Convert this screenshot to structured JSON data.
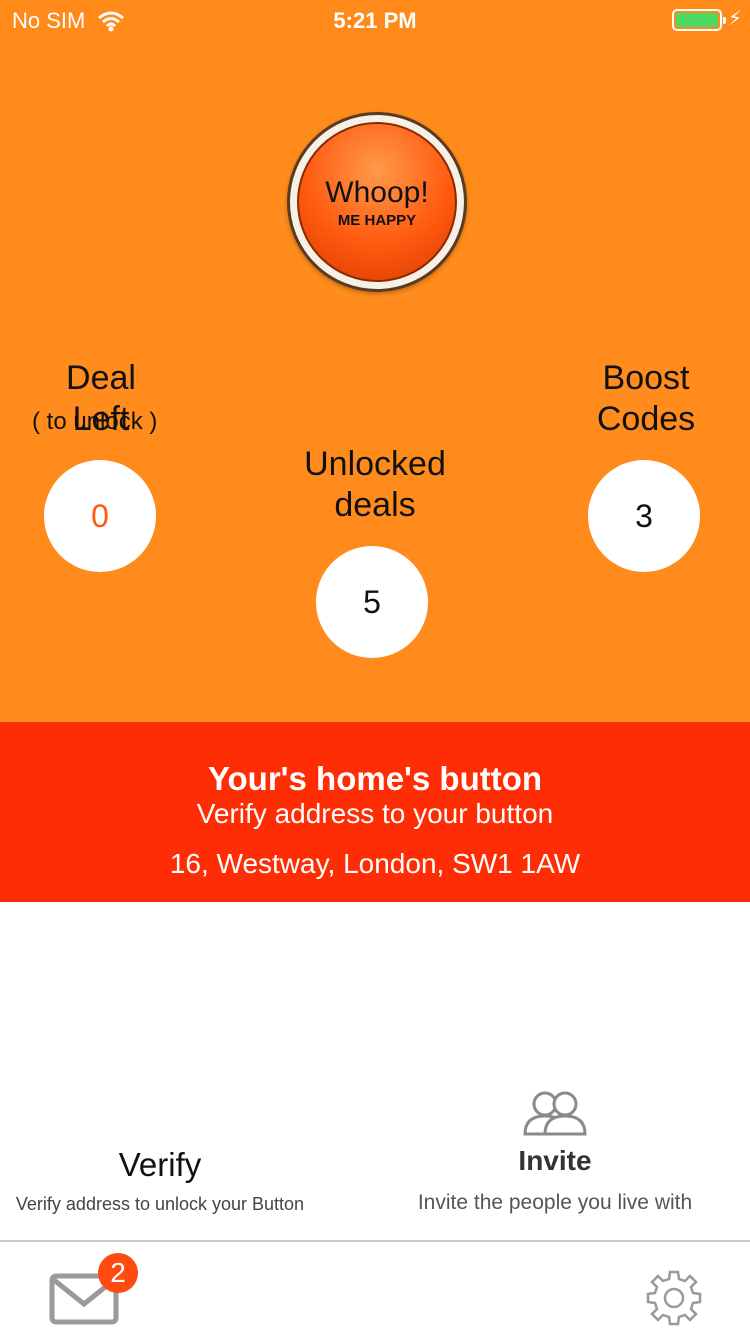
{
  "status": {
    "carrier": "No SIM",
    "time": "5:21 PM"
  },
  "whoop": {
    "title": "Whoop!",
    "subtitle": "ME HAPPY"
  },
  "stats": {
    "deal_left": {
      "label": "Deal Left",
      "hint": "( to unlock )",
      "value": "0"
    },
    "unlocked": {
      "label_line1": "Unlocked",
      "label_line2": "deals",
      "value": "5"
    },
    "boost": {
      "label_line1": "Boost",
      "label_line2": "Codes",
      "value": "3"
    }
  },
  "home": {
    "title": "Your's home's button",
    "subtitle": "Verify address to your button",
    "address": "16, Westway, London, SW1 1AW"
  },
  "actions": {
    "verify": {
      "title": "Verify",
      "desc": "Verify address to unlock your Button"
    },
    "invite": {
      "title": "Invite",
      "desc": "Invite the people you live with"
    }
  },
  "tabbar": {
    "mail_badge": "2"
  },
  "colors": {
    "hero_orange": "#ff8a1a",
    "band_red": "#ff2d05",
    "deal_value_orange": "#ff5a10"
  }
}
